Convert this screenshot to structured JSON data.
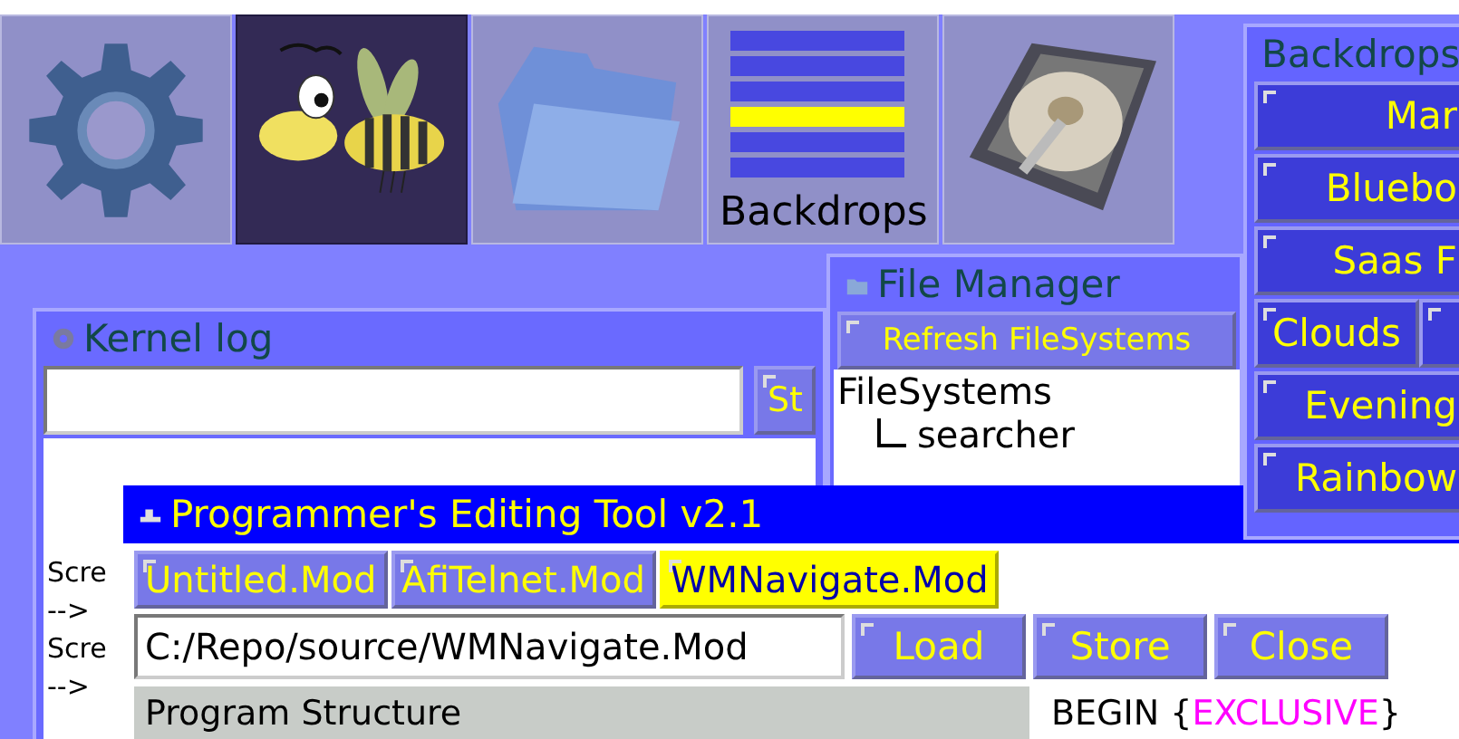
{
  "desktop_icons": [
    {
      "kind": "gear",
      "selected": false
    },
    {
      "kind": "bee",
      "selected": true
    },
    {
      "kind": "folder",
      "selected": false
    },
    {
      "kind": "backdrops",
      "selected": false,
      "label": "Backdrops"
    },
    {
      "kind": "disk",
      "selected": false
    }
  ],
  "kernel_log": {
    "title": "Kernel log",
    "button": "St",
    "lines": [
      "Scre",
      "-->",
      "Scre",
      "-->"
    ]
  },
  "file_manager": {
    "title": "File Manager",
    "refresh_button": "Refresh FileSystems",
    "tree": [
      {
        "label": "FileSystems",
        "expanded": true,
        "children": [
          {
            "label": "searcher"
          }
        ]
      }
    ]
  },
  "backdrops_panel": {
    "title": "Backdrops",
    "rows": [
      [
        "Mar"
      ],
      [
        "Bluebo"
      ],
      [
        "Saas F"
      ],
      [
        "Clouds",
        ""
      ],
      [
        "Evening"
      ],
      [
        "Rainbow"
      ]
    ]
  },
  "editor": {
    "title": "Programmer's Editing Tool v2.1",
    "tabs": [
      {
        "label": "Untitled.Mod",
        "selected": false
      },
      {
        "label": "AfiTelnet.Mod",
        "selected": false
      },
      {
        "label": "WMNavigate.Mod",
        "selected": true
      }
    ],
    "path": {
      "value": "C:/Repo/source/WMNavigate.Mod"
    },
    "buttons": [
      "Load",
      "Store",
      "Close"
    ],
    "structure_title": "Program Structure",
    "code_line": "BEGIN {**EXCLUSIVE**}"
  }
}
